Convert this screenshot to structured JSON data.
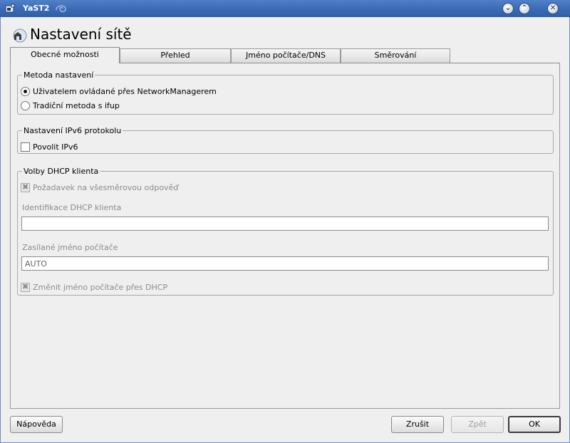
{
  "window": {
    "title": "YaST2",
    "minimize_glyph": "⌄",
    "maximize_glyph": "⌃",
    "close_glyph": "✕"
  },
  "page": {
    "heading": "Nastavení sítě"
  },
  "tabs": [
    {
      "label": "Obecné možnosti",
      "active": true
    },
    {
      "label": "Přehled",
      "active": false
    },
    {
      "label": "Jméno počítače/DNS",
      "active": false
    },
    {
      "label": "Směrování",
      "active": false
    }
  ],
  "method_group": {
    "legend": "Metoda nastavení",
    "options": [
      {
        "label": "Uživatelem ovládané přes NetworkManagerem",
        "selected": true
      },
      {
        "label": "Tradiční metoda s ifup",
        "selected": false
      }
    ]
  },
  "ipv6_group": {
    "legend": "Nastavení IPv6 protokolu",
    "enable_label": "Povolit IPv6",
    "enabled": false
  },
  "dhcp_group": {
    "legend": "Volby DHCP klienta",
    "broadcast_label": "Požadavek na všesměrovou odpověď",
    "broadcast_checked": true,
    "client_id_label": "Identifikace DHCP klienta",
    "client_id_value": "",
    "hostname_label": "Zasílané jméno počítače",
    "hostname_value": "AUTO",
    "change_hostname_label": "Změnit jméno počítače přes DHCP",
    "change_hostname_checked": true,
    "disabled": true
  },
  "buttons": {
    "help": "Nápověda",
    "cancel": "Zrušit",
    "back": "Zpět",
    "ok": "OK"
  },
  "colors": {
    "titlebar": "#3a68b2",
    "window_bg": "#efefef",
    "disabled_text": "#8c8c8c"
  },
  "icons": {
    "app": "yast-icon",
    "network": "network-home-icon",
    "suse": "suse-chameleon-icon"
  }
}
